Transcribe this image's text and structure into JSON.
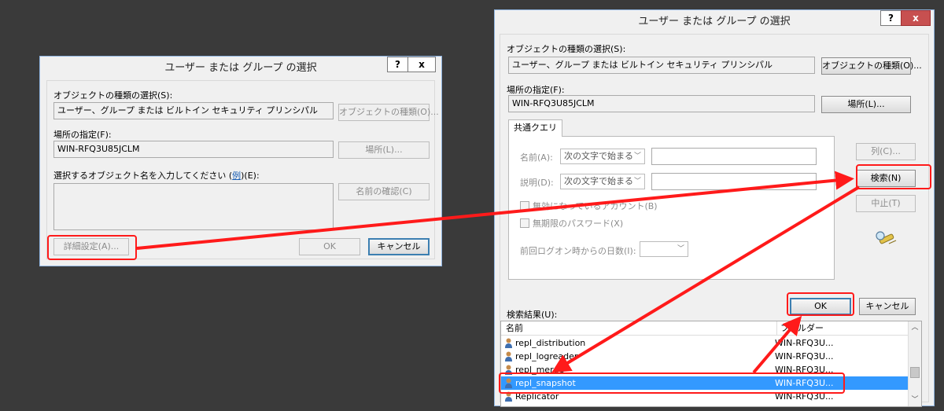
{
  "dialog_small": {
    "title": "ユーザー または グループ の選択",
    "help": "?",
    "close": "x",
    "object_type_label": "オブジェクトの種類の選択(S):",
    "object_type_value": "ユーザー、グループ または ビルトイン セキュリティ プリンシパル",
    "object_type_button": "オブジェクトの種類(O)...",
    "location_label": "場所の指定(F):",
    "location_value": "WIN-RFQ3U85JCLM",
    "location_button": "場所(L)...",
    "enter_names_prefix": "選択するオブジェクト名を入力してください (",
    "enter_names_link": "例",
    "enter_names_suffix": ")(E):",
    "check_names_button": "名前の確認(C)",
    "advanced_button": "詳細設定(A)...",
    "ok_button": "OK",
    "cancel_button": "キャンセル"
  },
  "dialog_large": {
    "title": "ユーザー または グループ の選択",
    "help": "?",
    "close": "x",
    "object_type_label": "オブジェクトの種類の選択(S):",
    "object_type_value": "ユーザー、グループ または ビルトイン セキュリティ プリンシパル",
    "object_type_button": "オブジェクトの種類(O)...",
    "location_label": "場所の指定(F):",
    "location_value": "WIN-RFQ3U85JCLM",
    "location_button": "場所(L)...",
    "tab_common_query": "共通クエリ",
    "name_label": "名前(A):",
    "name_select": "次の文字で始まる",
    "description_label": "説明(D):",
    "description_select": "次の文字で始まる",
    "disabled_accounts_label": "無効になっているアカウント(B)",
    "non_expiring_password_label": "無期限のパスワード(X)",
    "days_since_logon_label": "前回ログオン時からの日数(I):",
    "columns_button": "列(C)...",
    "search_button": "検索(N)",
    "stop_button": "中止(T)",
    "ok_button": "OK",
    "cancel_button": "キャンセル",
    "results_label": "検索結果(U):",
    "col_name": "名前",
    "col_folder": "フォルダー",
    "results": [
      {
        "name": "repl_distribution",
        "folder": "WIN-RFQ3U..."
      },
      {
        "name": "repl_logreader",
        "folder": "WIN-RFQ3U..."
      },
      {
        "name": "repl_merge",
        "folder": "WIN-RFQ3U..."
      },
      {
        "name": "repl_snapshot",
        "folder": "WIN-RFQ3U..."
      },
      {
        "name": "Replicator",
        "folder": "WIN-RFQ3U..."
      }
    ]
  },
  "colors": {
    "highlight": "#ff1a1a",
    "selection": "#3399ff",
    "background": "#3a3a3a"
  }
}
